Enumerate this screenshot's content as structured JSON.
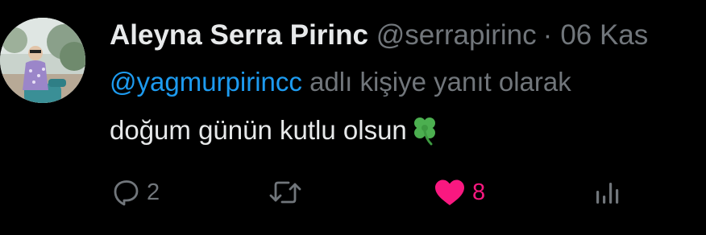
{
  "tweet": {
    "author_name": "Aleyna Serra Pirinc",
    "handle": "@serrapirinc",
    "separator": "·",
    "date": "06 Kas",
    "reply_to_mention": "@yagmurpirincc",
    "reply_to_suffix": " adlı kişiye yanıt olarak",
    "text": "doğum günün kutlu olsun",
    "emoji": "four-leaf-clover"
  },
  "actions": {
    "reply_count": "2",
    "retweet_count": "",
    "like_count": "8",
    "like_active": true
  },
  "colors": {
    "background": "#000000",
    "primary_text": "#e7e9ea",
    "secondary_text": "#71767b",
    "mention": "#1d9bf0",
    "like": "#f91880",
    "clover": "#4caf50"
  }
}
